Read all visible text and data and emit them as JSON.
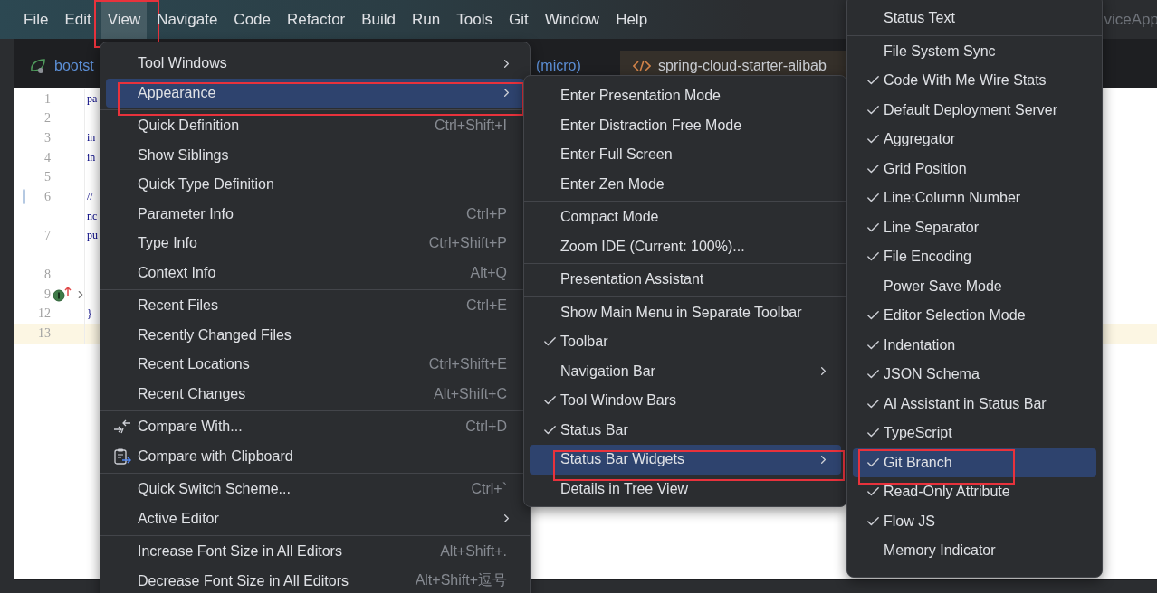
{
  "menu_bar": {
    "items": [
      {
        "label": "File",
        "selected": false,
        "highlighted": false
      },
      {
        "label": "Edit",
        "selected": false,
        "highlighted": false
      },
      {
        "label": "View",
        "selected": true,
        "highlighted": true
      },
      {
        "label": "Navigate",
        "selected": false,
        "highlighted": false
      },
      {
        "label": "Code",
        "selected": false,
        "highlighted": false
      },
      {
        "label": "Refactor",
        "selected": false,
        "highlighted": false
      },
      {
        "label": "Build",
        "selected": false,
        "highlighted": false
      },
      {
        "label": "Run",
        "selected": false,
        "highlighted": false
      },
      {
        "label": "Tools",
        "selected": false,
        "highlighted": false
      },
      {
        "label": "Git",
        "selected": false,
        "highlighted": false
      },
      {
        "label": "Window",
        "selected": false,
        "highlighted": false
      },
      {
        "label": "Help",
        "selected": false,
        "highlighted": false
      }
    ],
    "window_title": "viceApp"
  },
  "editor_tabs": [
    {
      "label": "bootst",
      "kind": "spring",
      "selected": false
    },
    {
      "label": "(micro)",
      "kind": "plain",
      "selected": false
    },
    {
      "label": "spring-cloud-starter-alibab",
      "kind": "xml",
      "selected": true
    }
  ],
  "editor": {
    "lines": [
      {
        "number": "1",
        "code": "pa",
        "kind": "plain",
        "changed": false,
        "current": false
      },
      {
        "number": "2",
        "kind": "plain",
        "changed": false,
        "current": false
      },
      {
        "number": "3",
        "code": "in",
        "kind": "plain",
        "changed": false,
        "current": false
      },
      {
        "number": "4",
        "code": "in",
        "kind": "plain",
        "changed": false,
        "current": false
      },
      {
        "number": "5",
        "kind": "plain",
        "changed": false,
        "current": false
      },
      {
        "number": "6",
        "code": "//",
        "kind": "plain",
        "changed": true,
        "current": false
      },
      {
        "code": "nc",
        "kind": "plain",
        "changed": false,
        "current": false
      },
      {
        "number": "7",
        "code": "pu",
        "kind": "plain",
        "changed": false,
        "current": false
      },
      {
        "kind": "plain",
        "changed": false,
        "current": false
      },
      {
        "number": "8",
        "kind": "plain",
        "changed": false,
        "current": false
      },
      {
        "number": "9",
        "kind": "implements",
        "changed": false,
        "current": false
      },
      {
        "number": "12",
        "code": "}",
        "kind": "plain",
        "changed": false,
        "current": false
      },
      {
        "number": "13",
        "kind": "plain",
        "changed": false,
        "current": true
      }
    ]
  },
  "menus": [
    {
      "items": [
        {
          "kind": "item",
          "label": "Tool Windows",
          "submenu": true,
          "selected": false,
          "highlighted": false
        },
        {
          "kind": "item",
          "label": "Appearance",
          "submenu": true,
          "selected": true,
          "highlighted": true
        },
        {
          "kind": "separator"
        },
        {
          "kind": "item",
          "label": "Quick Definition",
          "shortcut": "Ctrl+Shift+I",
          "submenu": false,
          "selected": false,
          "highlighted": false
        },
        {
          "kind": "item",
          "label": "Show Siblings",
          "submenu": false,
          "selected": false,
          "highlighted": false
        },
        {
          "kind": "item",
          "label": "Quick Type Definition",
          "submenu": false,
          "selected": false,
          "highlighted": false
        },
        {
          "kind": "item",
          "label": "Parameter Info",
          "shortcut": "Ctrl+P",
          "submenu": false,
          "selected": false,
          "highlighted": false
        },
        {
          "kind": "item",
          "label": "Type Info",
          "shortcut": "Ctrl+Shift+P",
          "submenu": false,
          "selected": false,
          "highlighted": false
        },
        {
          "kind": "item",
          "label": "Context Info",
          "shortcut": "Alt+Q",
          "submenu": false,
          "selected": false,
          "highlighted": false
        },
        {
          "kind": "separator"
        },
        {
          "kind": "item",
          "label": "Recent Files",
          "shortcut": "Ctrl+E",
          "submenu": false,
          "selected": false,
          "highlighted": false
        },
        {
          "kind": "item",
          "label": "Recently Changed Files",
          "submenu": false,
          "selected": false,
          "highlighted": false
        },
        {
          "kind": "item",
          "label": "Recent Locations",
          "shortcut": "Ctrl+Shift+E",
          "submenu": false,
          "selected": false,
          "highlighted": false
        },
        {
          "kind": "item",
          "label": "Recent Changes",
          "shortcut": "Alt+Shift+C",
          "submenu": false,
          "selected": false,
          "highlighted": false
        },
        {
          "kind": "separator"
        },
        {
          "kind": "compare-item",
          "label": "Compare With...",
          "shortcut": "Ctrl+D",
          "submenu": false,
          "selected": false,
          "highlighted": false
        },
        {
          "kind": "clipboard-item",
          "label": "Compare with Clipboard",
          "submenu": false,
          "selected": false,
          "highlighted": false
        },
        {
          "kind": "separator"
        },
        {
          "kind": "item",
          "label": "Quick Switch Scheme...",
          "shortcut": "Ctrl+`",
          "submenu": false,
          "selected": false,
          "highlighted": false
        },
        {
          "kind": "item",
          "label": "Active Editor",
          "submenu": true,
          "selected": false,
          "highlighted": false
        },
        {
          "kind": "separator"
        },
        {
          "kind": "item",
          "label": "Increase Font Size in All Editors",
          "shortcut": "Alt+Shift+.",
          "submenu": false,
          "selected": false,
          "highlighted": false
        },
        {
          "kind": "item",
          "label": "Decrease Font Size in All Editors",
          "shortcut": "Alt+Shift+逗号",
          "submenu": false,
          "selected": false,
          "highlighted": false
        }
      ]
    },
    {
      "items": [
        {
          "kind": "item",
          "label": "Enter Presentation Mode",
          "checked": false,
          "submenu": false,
          "selected": false,
          "highlighted": false
        },
        {
          "kind": "item",
          "label": "Enter Distraction Free Mode",
          "checked": false,
          "submenu": false,
          "selected": false,
          "highlighted": false
        },
        {
          "kind": "item",
          "label": "Enter Full Screen",
          "checked": false,
          "submenu": false,
          "selected": false,
          "highlighted": false
        },
        {
          "kind": "item",
          "label": "Enter Zen Mode",
          "checked": false,
          "submenu": false,
          "selected": false,
          "highlighted": false
        },
        {
          "kind": "separator"
        },
        {
          "kind": "item",
          "label": "Compact Mode",
          "checked": false,
          "submenu": false,
          "selected": false,
          "highlighted": false
        },
        {
          "kind": "item",
          "label": "Zoom IDE (Current: 100%)...",
          "checked": false,
          "submenu": false,
          "selected": false,
          "highlighted": false
        },
        {
          "kind": "separator"
        },
        {
          "kind": "item",
          "label": "Presentation Assistant",
          "checked": false,
          "submenu": false,
          "selected": false,
          "highlighted": false
        },
        {
          "kind": "separator"
        },
        {
          "kind": "item",
          "label": "Show Main Menu in Separate Toolbar",
          "checked": false,
          "submenu": false,
          "selected": false,
          "highlighted": false
        },
        {
          "kind": "item",
          "label": "Toolbar",
          "checked": true,
          "submenu": false,
          "selected": false,
          "highlighted": false
        },
        {
          "kind": "item",
          "label": "Navigation Bar",
          "checked": false,
          "submenu": true,
          "selected": false,
          "highlighted": false
        },
        {
          "kind": "item",
          "label": "Tool Window Bars",
          "checked": true,
          "submenu": false,
          "selected": false,
          "highlighted": false
        },
        {
          "kind": "item",
          "label": "Status Bar",
          "checked": true,
          "submenu": false,
          "selected": false,
          "highlighted": false
        },
        {
          "kind": "item",
          "label": "Status Bar Widgets",
          "checked": false,
          "submenu": true,
          "selected": true,
          "highlighted": true
        },
        {
          "kind": "item",
          "label": "Details in Tree View",
          "checked": false,
          "submenu": false,
          "selected": false,
          "highlighted": false
        }
      ]
    },
    {
      "items": [
        {
          "kind": "item",
          "label": "Status Text",
          "checked": false,
          "submenu": false,
          "selected": false,
          "highlighted": false
        },
        {
          "kind": "separator"
        },
        {
          "kind": "item",
          "label": "File System Sync",
          "checked": false,
          "submenu": false,
          "selected": false,
          "highlighted": false
        },
        {
          "kind": "item",
          "label": "Code With Me Wire Stats",
          "checked": true,
          "submenu": false,
          "selected": false,
          "highlighted": false
        },
        {
          "kind": "item",
          "label": "Default Deployment Server",
          "checked": true,
          "submenu": false,
          "selected": false,
          "highlighted": false
        },
        {
          "kind": "item",
          "label": "Aggregator",
          "checked": true,
          "submenu": false,
          "selected": false,
          "highlighted": false
        },
        {
          "kind": "item",
          "label": "Grid Position",
          "checked": true,
          "submenu": false,
          "selected": false,
          "highlighted": false
        },
        {
          "kind": "item",
          "label": "Line:Column Number",
          "checked": true,
          "submenu": false,
          "selected": false,
          "highlighted": false
        },
        {
          "kind": "item",
          "label": "Line Separator",
          "checked": true,
          "submenu": false,
          "selected": false,
          "highlighted": false
        },
        {
          "kind": "item",
          "label": "File Encoding",
          "checked": true,
          "submenu": false,
          "selected": false,
          "highlighted": false
        },
        {
          "kind": "item",
          "label": "Power Save Mode",
          "checked": false,
          "submenu": false,
          "selected": false,
          "highlighted": false
        },
        {
          "kind": "item",
          "label": "Editor Selection Mode",
          "checked": true,
          "submenu": false,
          "selected": false,
          "highlighted": false
        },
        {
          "kind": "item",
          "label": "Indentation",
          "checked": true,
          "submenu": false,
          "selected": false,
          "highlighted": false
        },
        {
          "kind": "item",
          "label": "JSON Schema",
          "checked": true,
          "submenu": false,
          "selected": false,
          "highlighted": false
        },
        {
          "kind": "item",
          "label": "AI Assistant in Status Bar",
          "checked": true,
          "submenu": false,
          "selected": false,
          "highlighted": false
        },
        {
          "kind": "item",
          "label": "TypeScript",
          "checked": true,
          "submenu": false,
          "selected": false,
          "highlighted": false
        },
        {
          "kind": "item",
          "label": "Git Branch",
          "checked": true,
          "submenu": false,
          "selected": true,
          "highlighted": true
        },
        {
          "kind": "item",
          "label": "Read-Only Attribute",
          "checked": true,
          "submenu": false,
          "selected": false,
          "highlighted": false
        },
        {
          "kind": "item",
          "label": "Flow JS",
          "checked": true,
          "submenu": false,
          "selected": false,
          "highlighted": false
        },
        {
          "kind": "item",
          "label": "Memory Indicator",
          "checked": false,
          "submenu": false,
          "selected": false,
          "highlighted": false
        }
      ]
    }
  ]
}
